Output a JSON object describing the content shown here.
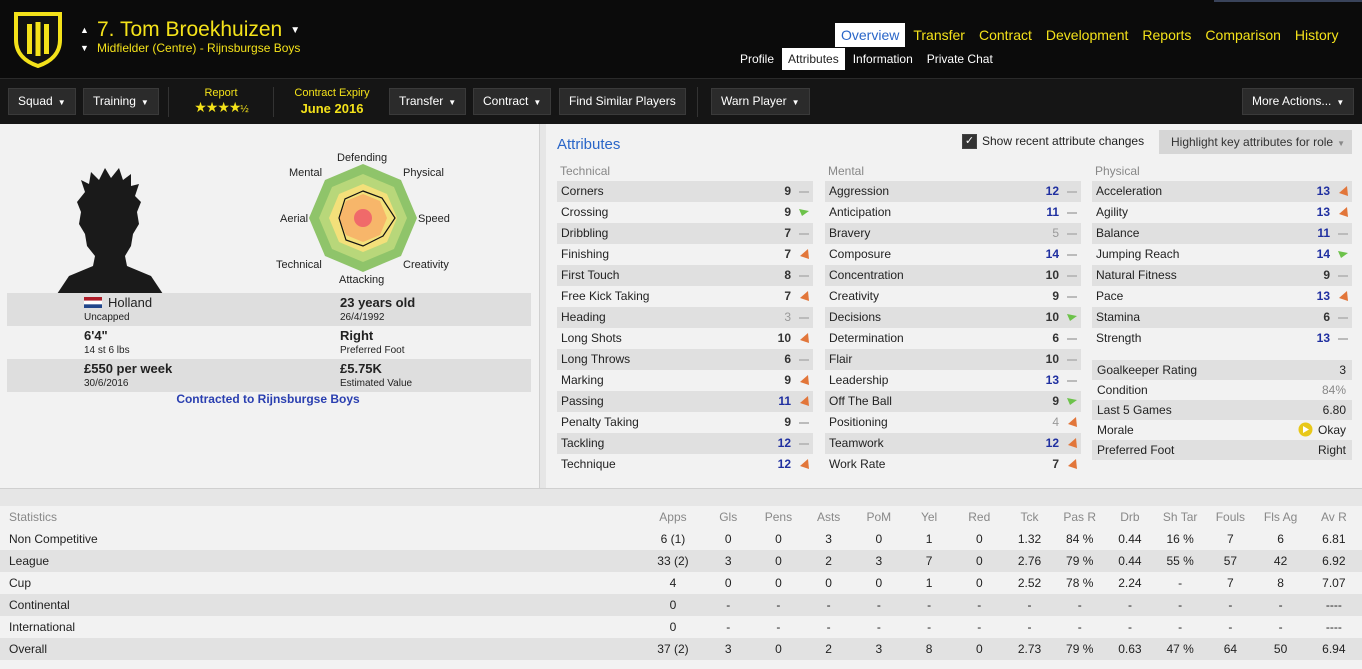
{
  "header": {
    "player_name": "7. Tom Broekhuizen",
    "player_subtitle": "Midfielder (Centre) - Rijnsburgse Boys",
    "main_tabs": [
      "Overview",
      "Transfer",
      "Contract",
      "Development",
      "Reports",
      "Comparison",
      "History"
    ],
    "active_main_tab": "Overview",
    "sub_tabs": [
      "Profile",
      "Attributes",
      "Information",
      "Private Chat"
    ],
    "active_sub_tab": "Attributes",
    "colors": {
      "accent": "#f4e21a",
      "active_tab_text": "#2a66c8"
    }
  },
  "toolbar": {
    "squad_label": "Squad",
    "training_label": "Training",
    "report_label": "Report",
    "report_stars": "★★★★",
    "report_half": "½",
    "report_rating": 4.5,
    "contract_label": "Contract Expiry",
    "contract_value": "June 2016",
    "transfer_label": "Transfer",
    "contract_btn_label": "Contract",
    "find_similar_label": "Find Similar Players",
    "warn_label": "Warn Player",
    "more_actions_label": "More Actions..."
  },
  "profile": {
    "radar_labels": {
      "defending": "Defending",
      "physical": "Physical",
      "speed": "Speed",
      "creativity": "Creativity",
      "attacking": "Attacking",
      "technical": "Technical",
      "aerial": "Aerial",
      "mental": "Mental"
    },
    "nation": "Holland",
    "caps": "Uncapped",
    "age": "23 years old",
    "dob": "26/4/1992",
    "height": "6'4\"",
    "weight": "14 st 6 lbs",
    "foot": "Right",
    "foot_label": "Preferred Foot",
    "wage": "£550 per week",
    "wage_expiry": "30/6/2016",
    "value": "£5.75K",
    "value_label": "Estimated Value",
    "contracted": "Contracted to Rijnsburgse Boys"
  },
  "attributes": {
    "title": "Attributes",
    "recent_changes_label": "Show recent attribute changes",
    "recent_changes_checked": true,
    "highlight_label": "Highlight key attributes for role",
    "technical_head": "Technical",
    "mental_head": "Mental",
    "physical_head": "Physical",
    "technical": [
      {
        "name": "Corners",
        "value": "9",
        "trend": "flat"
      },
      {
        "name": "Crossing",
        "value": "9",
        "trend": "up"
      },
      {
        "name": "Dribbling",
        "value": "7",
        "trend": "flat"
      },
      {
        "name": "Finishing",
        "value": "7",
        "trend": "down"
      },
      {
        "name": "First Touch",
        "value": "8",
        "trend": "flat"
      },
      {
        "name": "Free Kick Taking",
        "value": "7",
        "trend": "down"
      },
      {
        "name": "Heading",
        "value": "3",
        "trend": "flat"
      },
      {
        "name": "Long Shots",
        "value": "10",
        "trend": "down"
      },
      {
        "name": "Long Throws",
        "value": "6",
        "trend": "flat"
      },
      {
        "name": "Marking",
        "value": "9",
        "trend": "down"
      },
      {
        "name": "Passing",
        "value": "11",
        "trend": "down"
      },
      {
        "name": "Penalty Taking",
        "value": "9",
        "trend": "flat"
      },
      {
        "name": "Tackling",
        "value": "12",
        "trend": "flat"
      },
      {
        "name": "Technique",
        "value": "12",
        "trend": "down"
      }
    ],
    "mental": [
      {
        "name": "Aggression",
        "value": "12",
        "trend": "flat"
      },
      {
        "name": "Anticipation",
        "value": "11",
        "trend": "flat"
      },
      {
        "name": "Bravery",
        "value": "5",
        "trend": "flat"
      },
      {
        "name": "Composure",
        "value": "14",
        "trend": "flat"
      },
      {
        "name": "Concentration",
        "value": "10",
        "trend": "flat"
      },
      {
        "name": "Creativity",
        "value": "9",
        "trend": "flat"
      },
      {
        "name": "Decisions",
        "value": "10",
        "trend": "up"
      },
      {
        "name": "Determination",
        "value": "6",
        "trend": "flat"
      },
      {
        "name": "Flair",
        "value": "10",
        "trend": "flat"
      },
      {
        "name": "Leadership",
        "value": "13",
        "trend": "flat"
      },
      {
        "name": "Off The Ball",
        "value": "9",
        "trend": "up"
      },
      {
        "name": "Positioning",
        "value": "4",
        "trend": "down"
      },
      {
        "name": "Teamwork",
        "value": "12",
        "trend": "down"
      },
      {
        "name": "Work Rate",
        "value": "7",
        "trend": "down"
      }
    ],
    "physical": [
      {
        "name": "Acceleration",
        "value": "13",
        "trend": "down"
      },
      {
        "name": "Agility",
        "value": "13",
        "trend": "down"
      },
      {
        "name": "Balance",
        "value": "11",
        "trend": "flat"
      },
      {
        "name": "Jumping Reach",
        "value": "14",
        "trend": "up"
      },
      {
        "name": "Natural Fitness",
        "value": "9",
        "trend": "flat"
      },
      {
        "name": "Pace",
        "value": "13",
        "trend": "down"
      },
      {
        "name": "Stamina",
        "value": "6",
        "trend": "flat"
      },
      {
        "name": "Strength",
        "value": "13",
        "trend": "flat"
      }
    ],
    "extra": [
      {
        "name": "Goalkeeper Rating",
        "value": "3"
      },
      {
        "name": "Condition",
        "value": "84%"
      },
      {
        "name": "Last 5 Games",
        "value": "6.80"
      },
      {
        "name": "Morale",
        "value": "Okay"
      },
      {
        "name": "Preferred Foot",
        "value": "Right"
      }
    ]
  },
  "statistics": {
    "headers": [
      "Statistics",
      "Apps",
      "Gls",
      "Pens",
      "Asts",
      "PoM",
      "Yel",
      "Red",
      "Tck",
      "Pas R",
      "Drb",
      "Sh Tar",
      "Fouls",
      "Fls Ag",
      "Av R"
    ],
    "rows": [
      [
        "Non Competitive",
        "6 (1)",
        "0",
        "0",
        "3",
        "0",
        "1",
        "0",
        "1.32",
        "84 %",
        "0.44",
        "16 %",
        "7",
        "6",
        "6.81"
      ],
      [
        "League",
        "33 (2)",
        "3",
        "0",
        "2",
        "3",
        "7",
        "0",
        "2.76",
        "79 %",
        "0.44",
        "55 %",
        "57",
        "42",
        "6.92"
      ],
      [
        "Cup",
        "4",
        "0",
        "0",
        "0",
        "0",
        "1",
        "0",
        "2.52",
        "78 %",
        "2.24",
        "-",
        "7",
        "8",
        "7.07"
      ],
      [
        "Continental",
        "0",
        "-",
        "-",
        "-",
        "-",
        "-",
        "-",
        "-",
        "-",
        "-",
        "-",
        "-",
        "-",
        "----"
      ],
      [
        "International",
        "0",
        "-",
        "-",
        "-",
        "-",
        "-",
        "-",
        "-",
        "-",
        "-",
        "-",
        "-",
        "-",
        "----"
      ],
      [
        "Overall",
        "37 (2)",
        "3",
        "0",
        "2",
        "3",
        "8",
        "0",
        "2.73",
        "79 %",
        "0.63",
        "47 %",
        "64",
        "50",
        "6.94"
      ]
    ]
  }
}
